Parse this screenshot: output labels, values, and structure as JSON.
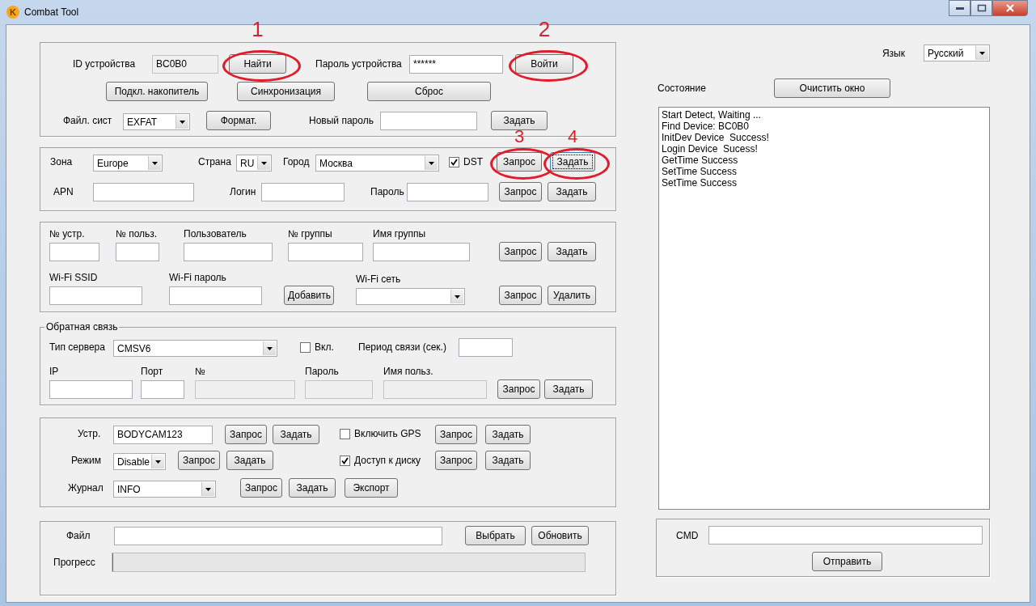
{
  "window": {
    "title": "Combat Tool",
    "icon_letter": "K"
  },
  "groups": [
    {
      "rows": [
        {
          "items": [
            {
              "kind": "label",
              "text": "ID устройства"
            },
            {
              "kind": "field",
              "value": "BC0B0",
              "disabled": true
            },
            {
              "kind": "button",
              "label": "Найти",
              "focused": false,
              "marker": "1"
            },
            {
              "kind": "label",
              "text": "Пароль устройства"
            },
            {
              "kind": "field",
              "value": "******",
              "disabled": false
            },
            {
              "kind": "button",
              "label": "Войти",
              "focused": false,
              "marker": "2"
            }
          ]
        },
        {
          "items": [
            {
              "kind": "button",
              "label": "Подкл. накопитель",
              "focused": false
            },
            {
              "kind": "button",
              "label": "Синхронизация",
              "focused": false
            },
            {
              "kind": "button",
              "label": "Сброс",
              "focused": false
            }
          ]
        },
        {
          "items": [
            {
              "kind": "label",
              "text": "Файл. сист"
            },
            {
              "kind": "combo",
              "value": "EXFAT"
            },
            {
              "kind": "button",
              "label": "Формат.",
              "focused": false
            },
            {
              "kind": "label",
              "text": "Новый пароль"
            },
            {
              "kind": "field",
              "disabled": false
            },
            {
              "kind": "button",
              "label": "Задать",
              "focused": false
            }
          ]
        }
      ]
    },
    {
      "rows": [
        {
          "items": [
            {
              "kind": "label",
              "text": "Зона"
            },
            {
              "kind": "combo",
              "value": "Europe"
            },
            {
              "kind": "label",
              "text": "Страна"
            },
            {
              "kind": "combo",
              "value": "RU"
            },
            {
              "kind": "label",
              "text": "Город"
            },
            {
              "kind": "combo",
              "value": "Москва"
            },
            {
              "kind": "checkbox",
              "label": "DST",
              "checked": true
            },
            {
              "kind": "button",
              "label": "Запрос",
              "focused": false,
              "marker": "3"
            },
            {
              "kind": "button",
              "label": "Задать",
              "focused": true,
              "marker": "4"
            }
          ]
        },
        {
          "items": [
            {
              "kind": "label",
              "text": "APN"
            },
            {
              "kind": "field",
              "disabled": false
            },
            {
              "kind": "label",
              "text": "Логин"
            },
            {
              "kind": "field",
              "disabled": false
            },
            {
              "kind": "label",
              "text": "Пароль"
            },
            {
              "kind": "field",
              "disabled": false
            },
            {
              "kind": "button",
              "label": "Запрос",
              "focused": false
            },
            {
              "kind": "button",
              "label": "Задать",
              "focused": false
            }
          ]
        }
      ]
    },
    {
      "rows": [
        {
          "items": [
            {
              "kind": "field",
              "caption": "№ устр.",
              "disabled": false
            },
            {
              "kind": "field",
              "caption": "№ польз.",
              "disabled": false
            },
            {
              "kind": "field",
              "caption": "Пользователь",
              "disabled": false
            },
            {
              "kind": "field",
              "caption": "№ группы",
              "disabled": false
            },
            {
              "kind": "field",
              "caption": "Имя группы",
              "disabled": false
            },
            {
              "kind": "button",
              "label": "Запрос",
              "focused": false
            },
            {
              "kind": "button",
              "label": "Задать",
              "focused": false
            }
          ]
        },
        {
          "items": [
            {
              "kind": "field",
              "caption": "Wi-Fi SSID",
              "disabled": false
            },
            {
              "kind": "field",
              "caption": "Wi-Fi пароль",
              "disabled": false
            },
            {
              "kind": "button",
              "label": "Добавить",
              "focused": false
            },
            {
              "kind": "combo",
              "caption": "Wi-Fi сеть"
            },
            {
              "kind": "button",
              "label": "Запрос",
              "focused": false
            },
            {
              "kind": "button",
              "label": "Удалить",
              "focused": false
            }
          ]
        }
      ]
    },
    {
      "title": "Обратная связь",
      "rows": [
        {
          "items": [
            {
              "kind": "label",
              "text": "Тип сервера"
            },
            {
              "kind": "combo",
              "value": "CMSV6"
            },
            {
              "kind": "checkbox",
              "label": "Вкл.",
              "checked": false
            },
            {
              "kind": "label",
              "text": "Период связи (сек.)"
            },
            {
              "kind": "field",
              "disabled": false
            }
          ]
        },
        {
          "items": [
            {
              "kind": "field",
              "caption": "IP",
              "disabled": false
            },
            {
              "kind": "field",
              "caption": "Порт",
              "disabled": false
            },
            {
              "kind": "field",
              "caption": "№",
              "disabled": true
            },
            {
              "kind": "field",
              "caption": "Пароль",
              "disabled": true
            },
            {
              "kind": "field",
              "caption": "Имя польз.",
              "disabled": true
            },
            {
              "kind": "button",
              "label": "Запрос",
              "focused": false
            },
            {
              "kind": "button",
              "label": "Задать",
              "focused": false
            }
          ]
        }
      ]
    },
    {
      "rows": [
        {
          "items": [
            {
              "kind": "label",
              "text": "Устр."
            },
            {
              "kind": "field",
              "value": "BODYCAM123",
              "disabled": false
            },
            {
              "kind": "button",
              "label": "Запрос",
              "focused": false
            },
            {
              "kind": "button",
              "label": "Задать",
              "focused": false
            },
            {
              "kind": "checkbox",
              "label": "Включить GPS",
              "checked": false
            },
            {
              "kind": "button",
              "label": "Запрос",
              "focused": false
            },
            {
              "kind": "button",
              "label": "Задать",
              "focused": false
            }
          ]
        },
        {
          "items": [
            {
              "kind": "label",
              "text": "Режим"
            },
            {
              "kind": "combo",
              "value": "Disable"
            },
            {
              "kind": "button",
              "label": "Запрос",
              "focused": false
            },
            {
              "kind": "button",
              "label": "Задать",
              "focused": false
            },
            {
              "kind": "checkbox",
              "label": "Доступ к диску",
              "checked": true
            },
            {
              "kind": "button",
              "label": "Запрос",
              "focused": false
            },
            {
              "kind": "button",
              "label": "Задать",
              "focused": false
            }
          ]
        },
        {
          "items": [
            {
              "kind": "label",
              "text": "Журнал"
            },
            {
              "kind": "combo",
              "value": "INFO"
            },
            {
              "kind": "button",
              "label": "Запрос",
              "focused": false
            },
            {
              "kind": "button",
              "label": "Задать",
              "focused": false
            },
            {
              "kind": "button",
              "label": "Экспорт",
              "focused": false
            }
          ]
        }
      ]
    },
    {
      "rows": [
        {
          "items": [
            {
              "kind": "label",
              "text": "Файл"
            },
            {
              "kind": "field",
              "disabled": false
            },
            {
              "kind": "button",
              "label": "Выбрать",
              "focused": false
            },
            {
              "kind": "button",
              "label": "Обновить",
              "focused": false
            }
          ]
        },
        {
          "items": [
            {
              "kind": "label",
              "text": "Прогресс"
            },
            {
              "kind": "progress",
              "level": 0
            }
          ]
        }
      ]
    }
  ],
  "language": {
    "label": "Язык",
    "value": "Русский"
  },
  "status": {
    "label": "Состояние",
    "clear_button": "Очистить окно",
    "log": [
      "Start Detect, Waiting ...",
      "Find Device: BC0B0",
      "InitDev Device  Success!",
      "Login Device  Sucess!",
      "GetTime Success",
      "SetTime Success",
      "SetTime Success"
    ]
  },
  "cmd": {
    "label": "CMD",
    "send_button": "Отправить"
  }
}
